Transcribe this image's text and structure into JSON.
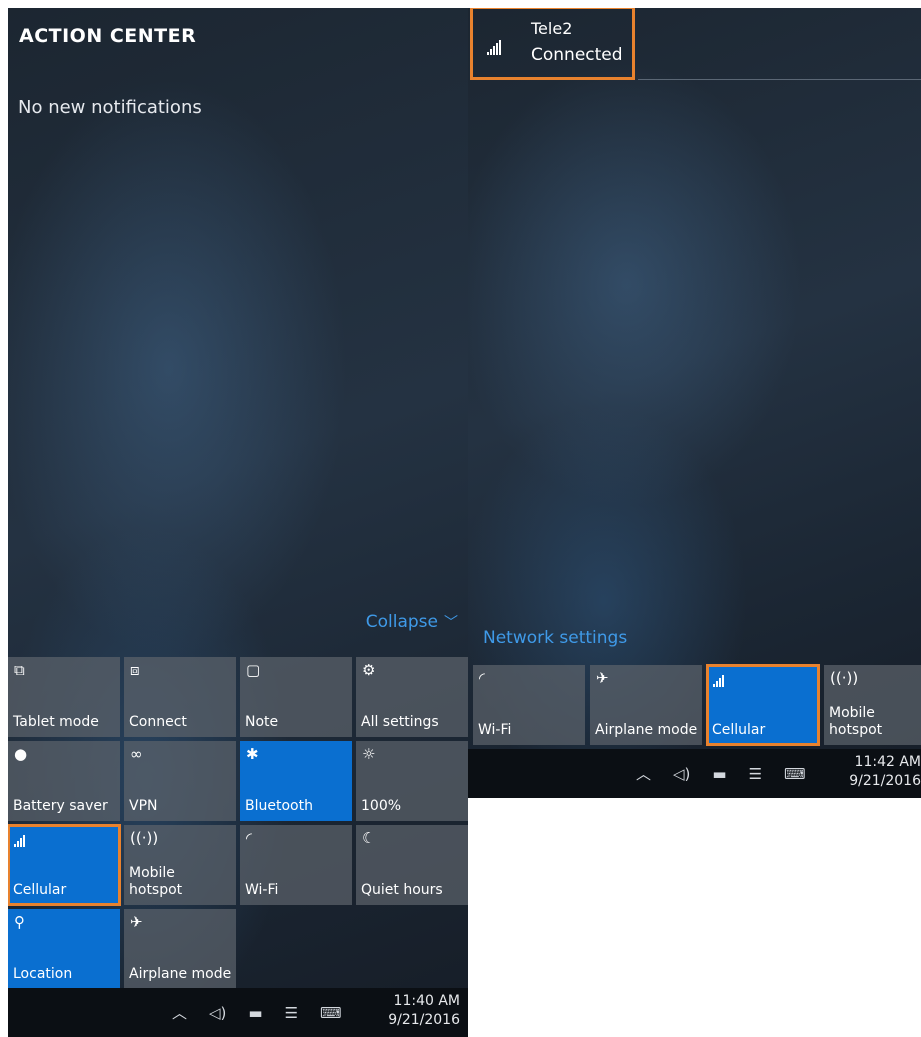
{
  "left": {
    "title": "ACTION CENTER",
    "notifications": "No new notifications",
    "collapse_label": "Collapse",
    "tiles": [
      {
        "label": "Tablet mode",
        "icon": "tablet-mode-icon",
        "glyph": "⧉",
        "active": false
      },
      {
        "label": "Connect",
        "icon": "connect-icon",
        "glyph": "⧈",
        "active": false
      },
      {
        "label": "Note",
        "icon": "note-icon",
        "glyph": "▢",
        "active": false
      },
      {
        "label": "All settings",
        "icon": "gear-icon",
        "glyph": "⚙",
        "active": false
      },
      {
        "label": "Battery saver",
        "icon": "battery-saver-icon",
        "glyph": "●",
        "active": false
      },
      {
        "label": "VPN",
        "icon": "vpn-icon",
        "glyph": "∞",
        "active": false
      },
      {
        "label": "Bluetooth",
        "icon": "bluetooth-icon",
        "glyph": "✱",
        "active": true
      },
      {
        "label": "100%",
        "icon": "brightness-icon",
        "glyph": "☼",
        "active": false
      },
      {
        "label": "Cellular",
        "icon": "cellular-icon",
        "glyph": "",
        "active": true
      },
      {
        "label": "Mobile hotspot",
        "icon": "mobile-hotspot-icon",
        "glyph": "((·))",
        "active": false
      },
      {
        "label": "Wi-Fi",
        "icon": "wifi-icon",
        "glyph": "◜",
        "active": false
      },
      {
        "label": "Quiet hours",
        "icon": "quiet-hours-icon",
        "glyph": "☾",
        "active": false
      },
      {
        "label": "Location",
        "icon": "location-icon",
        "glyph": "⚲",
        "active": true
      },
      {
        "label": "Airplane mode",
        "icon": "airplane-icon",
        "glyph": "✈",
        "active": false
      }
    ],
    "clock": {
      "time": "11:40 AM",
      "date": "9/21/2016"
    }
  },
  "right": {
    "network": {
      "name": "Tele2",
      "status": "Connected"
    },
    "network_settings": "Network settings",
    "tiles": [
      {
        "label": "Wi-Fi",
        "icon": "wifi-icon",
        "glyph": "◜",
        "active": false
      },
      {
        "label": "Airplane mode",
        "icon": "airplane-icon",
        "glyph": "✈",
        "active": false
      },
      {
        "label": "Cellular",
        "icon": "cellular-icon",
        "glyph": "",
        "active": true
      },
      {
        "label": "Mobile hotspot",
        "icon": "mobile-hotspot-icon",
        "glyph": "((·))",
        "active": false
      }
    ],
    "clock": {
      "time": "11:42 AM",
      "date": "9/21/2016"
    }
  },
  "taskbar_icons": [
    {
      "icon": "chevron-up-icon",
      "glyph": "︿"
    },
    {
      "icon": "volume-icon",
      "glyph": "◁)"
    },
    {
      "icon": "battery-icon",
      "glyph": "▬"
    },
    {
      "icon": "action-center-icon",
      "glyph": "☰"
    },
    {
      "icon": "keyboard-icon",
      "glyph": "⌨"
    }
  ],
  "colors": {
    "accent": "#0a6fd0",
    "highlight": "#e8822e",
    "link": "#3f9ae8"
  }
}
